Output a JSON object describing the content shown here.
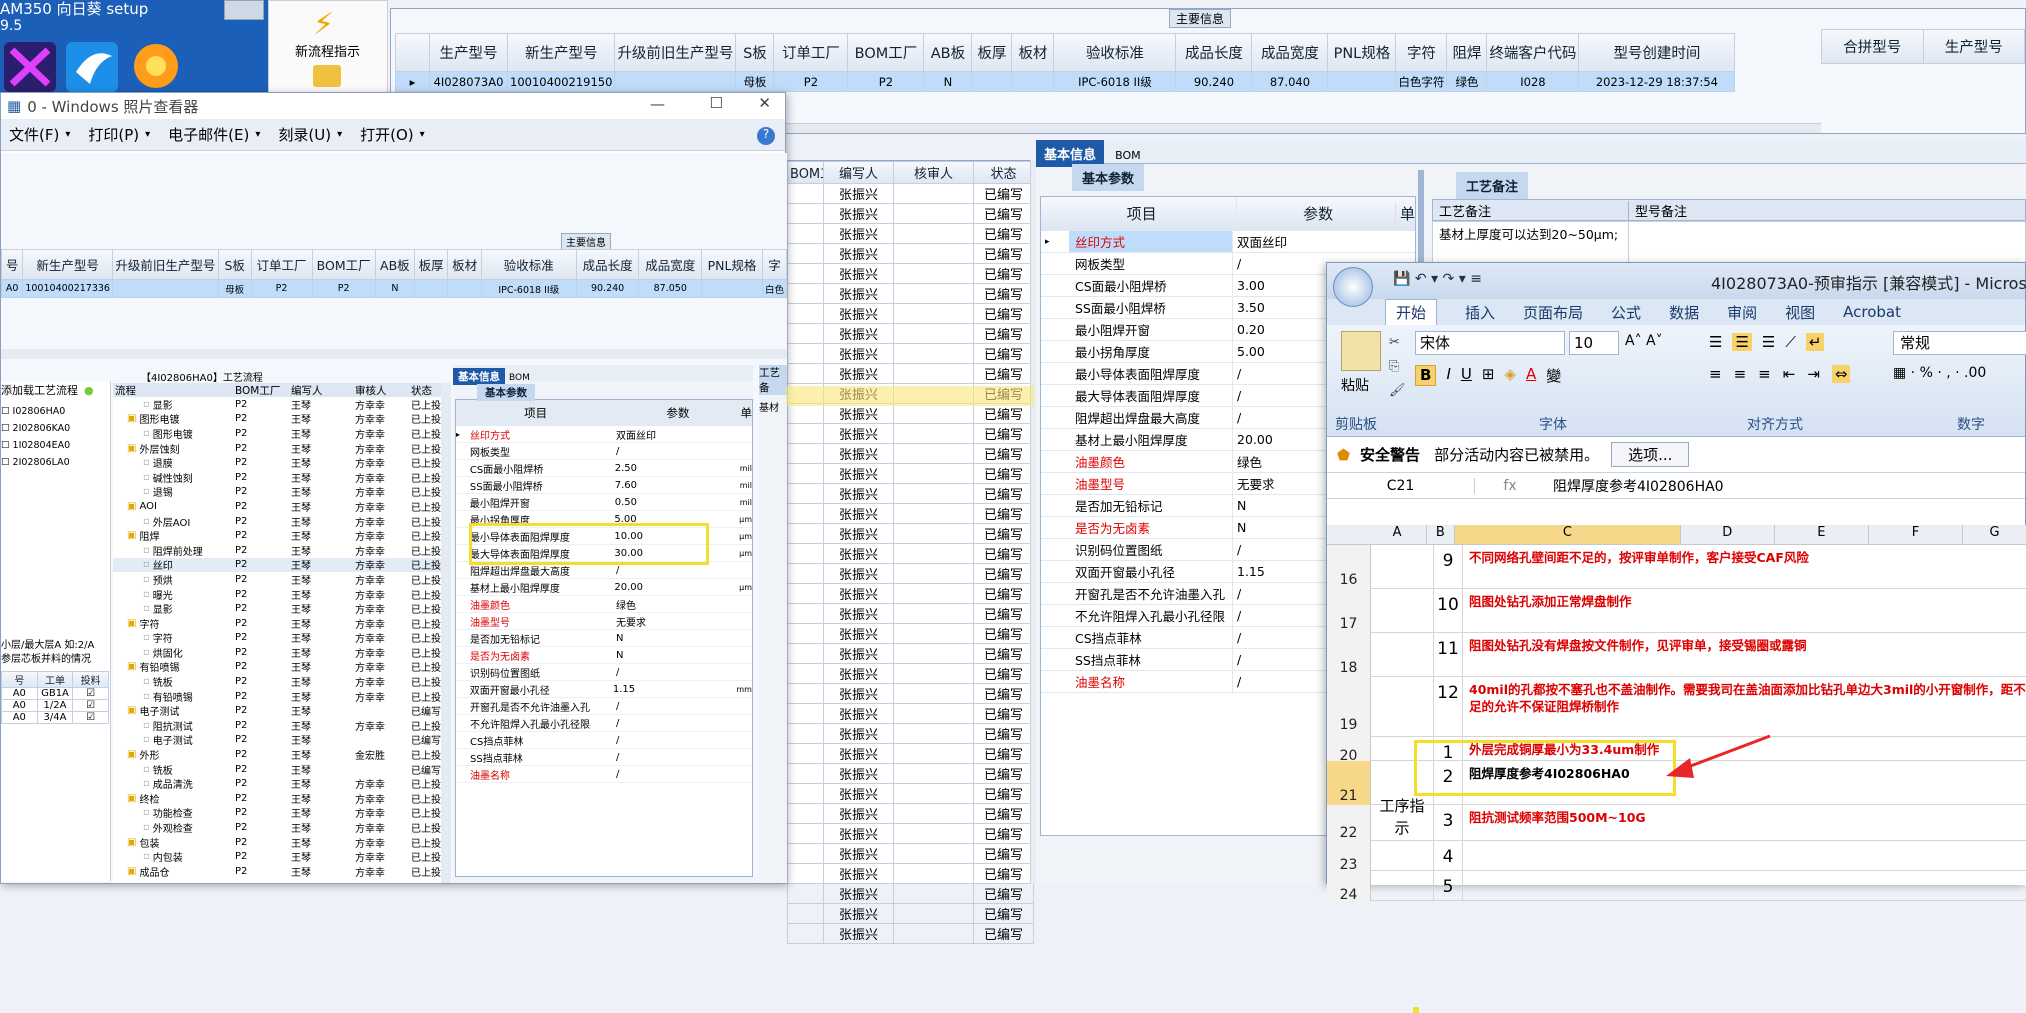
{
  "desktop": {
    "title": "AM350   向日葵    setup",
    "version": "9.5",
    "flow_label": "新流程指示"
  },
  "top_grid": {
    "caption": "主要信息",
    "columns": [
      "生产型号",
      "新生产型号",
      "升级前旧生产型号",
      "S板",
      "订单工厂",
      "BOM工厂",
      "AB板",
      "板厚",
      "板材",
      "验收标准",
      "成品长度",
      "成品宽度",
      "PNL规格",
      "字符",
      "阻焊",
      "终端客户代码",
      "型号创建时间"
    ],
    "row": [
      "4I028073A0",
      "10010400219150",
      "",
      "母板",
      "P2",
      "P2",
      "N",
      "",
      "",
      "IPC-6018 II级",
      "90.240",
      "87.040",
      "",
      "白色字符",
      "绿色",
      "I028",
      "2023-12-29 18:37:54"
    ],
    "right_columns": [
      "合拼型号",
      "生产型号"
    ]
  },
  "photo_viewer": {
    "title": "0 - Windows 照片查看器",
    "menu": [
      "文件(F)",
      "打印(P)",
      "电子邮件(E)",
      "刻录(U)",
      "打开(O)"
    ],
    "caption": "主要信息",
    "columns": [
      "号",
      "新生产型号",
      "升级前旧生产型号",
      "S板",
      "订单工厂",
      "BOM工厂",
      "AB板",
      "板厚",
      "板材",
      "验收标准",
      "成品长度",
      "成品宽度",
      "PNL规格",
      "字"
    ],
    "row": [
      "A0",
      "10010400217336",
      "",
      "母板",
      "P2",
      "P2",
      "N",
      "",
      "",
      "IPC-6018 II级",
      "90.240",
      "87.050",
      "",
      "白色"
    ],
    "flow_caption": "【4I02806HA0】工艺流程",
    "left_items": [
      "添加载工艺流程",
      "I02806HA0",
      "2I02806KA0",
      "1I02804EA0",
      "2I02806LA0"
    ],
    "note_lines": [
      "小层/最大层A 如:2/A",
      "参层芯板并料的情况"
    ],
    "small_table_head": [
      "号",
      "工单",
      "投料"
    ],
    "small_table_rows": [
      [
        "A0",
        "GB1A",
        ""
      ],
      [
        "A0",
        "1/2A",
        ""
      ],
      [
        "A0",
        "3/4A",
        ""
      ]
    ],
    "tree_head": [
      "流程",
      "BOM工厂",
      "编写人",
      "审核人",
      "状态"
    ],
    "tree": [
      {
        "t": "显影",
        "d": 2,
        "f": "P2",
        "w": "王琴",
        "r": "方幸幸",
        "s": "已上投"
      },
      {
        "t": "图形电镀",
        "d": 1,
        "f": "P2",
        "w": "王琴",
        "r": "方幸幸",
        "s": "已上投"
      },
      {
        "t": "图形电镀",
        "d": 2,
        "f": "P2",
        "w": "王琴",
        "r": "方幸幸",
        "s": "已上投"
      },
      {
        "t": "外层蚀刻",
        "d": 1,
        "f": "P2",
        "w": "王琴",
        "r": "方幸幸",
        "s": "已上投"
      },
      {
        "t": "退膜",
        "d": 2,
        "f": "P2",
        "w": "王琴",
        "r": "方幸幸",
        "s": "已上投"
      },
      {
        "t": "碱性蚀刻",
        "d": 2,
        "f": "P2",
        "w": "王琴",
        "r": "方幸幸",
        "s": "已上投"
      },
      {
        "t": "退锡",
        "d": 2,
        "f": "P2",
        "w": "王琴",
        "r": "方幸幸",
        "s": "已上投"
      },
      {
        "t": "AOI",
        "d": 1,
        "f": "P2",
        "w": "王琴",
        "r": "方幸幸",
        "s": "已上投"
      },
      {
        "t": "外层AOI",
        "d": 2,
        "f": "P2",
        "w": "王琴",
        "r": "方幸幸",
        "s": "已上投"
      },
      {
        "t": "阻焊",
        "d": 1,
        "f": "P2",
        "w": "王琴",
        "r": "方幸幸",
        "s": "已上投"
      },
      {
        "t": "阻焊前处理",
        "d": 2,
        "f": "P2",
        "w": "王琴",
        "r": "方幸幸",
        "s": "已上投"
      },
      {
        "t": "丝印",
        "d": 2,
        "f": "P2",
        "w": "王琴",
        "r": "方幸幸",
        "s": "已上投",
        "sel": true
      },
      {
        "t": "预烘",
        "d": 2,
        "f": "P2",
        "w": "王琴",
        "r": "方幸幸",
        "s": "已上投"
      },
      {
        "t": "曝光",
        "d": 2,
        "f": "P2",
        "w": "王琴",
        "r": "方幸幸",
        "s": "已上投"
      },
      {
        "t": "显影",
        "d": 2,
        "f": "P2",
        "w": "王琴",
        "r": "方幸幸",
        "s": "已上投"
      },
      {
        "t": "字符",
        "d": 1,
        "f": "P2",
        "w": "王琴",
        "r": "方幸幸",
        "s": "已上投"
      },
      {
        "t": "字符",
        "d": 2,
        "f": "P2",
        "w": "王琴",
        "r": "方幸幸",
        "s": "已上投"
      },
      {
        "t": "烘固化",
        "d": 2,
        "f": "P2",
        "w": "王琴",
        "r": "方幸幸",
        "s": "已上投"
      },
      {
        "t": "有铅喷锡",
        "d": 1,
        "f": "P2",
        "w": "王琴",
        "r": "方幸幸",
        "s": "已上投"
      },
      {
        "t": "铣板",
        "d": 2,
        "f": "P2",
        "w": "王琴",
        "r": "方幸幸",
        "s": "已上投"
      },
      {
        "t": "有铅喷锡",
        "d": 2,
        "f": "P2",
        "w": "王琴",
        "r": "方幸幸",
        "s": "已上投"
      },
      {
        "t": "电子测试",
        "d": 1,
        "f": "P2",
        "w": "王琴",
        "r": "",
        "s": "已编写"
      },
      {
        "t": "阻抗测试",
        "d": 2,
        "f": "P2",
        "w": "王琴",
        "r": "方幸幸",
        "s": "已上投"
      },
      {
        "t": "电子测试",
        "d": 2,
        "f": "P2",
        "w": "王琴",
        "r": "",
        "s": "已编写"
      },
      {
        "t": "外形",
        "d": 1,
        "f": "P2",
        "w": "王琴",
        "r": "金宏胜",
        "s": "已上投"
      },
      {
        "t": "铣板",
        "d": 2,
        "f": "P2",
        "w": "王琴",
        "r": "",
        "s": "已编写"
      },
      {
        "t": "成品清洗",
        "d": 2,
        "f": "P2",
        "w": "王琴",
        "r": "方幸幸",
        "s": "已上投"
      },
      {
        "t": "终检",
        "d": 1,
        "f": "P2",
        "w": "王琴",
        "r": "方幸幸",
        "s": "已上投"
      },
      {
        "t": "功能检查",
        "d": 2,
        "f": "P2",
        "w": "王琴",
        "r": "方幸幸",
        "s": "已上投"
      },
      {
        "t": "外观检查",
        "d": 2,
        "f": "P2",
        "w": "王琴",
        "r": "方幸幸",
        "s": "已上投"
      },
      {
        "t": "包装",
        "d": 1,
        "f": "P2",
        "w": "王琴",
        "r": "方幸幸",
        "s": "已上投"
      },
      {
        "t": "内包装",
        "d": 2,
        "f": "P2",
        "w": "王琴",
        "r": "方幸幸",
        "s": "已上投"
      },
      {
        "t": "成品仓",
        "d": 1,
        "f": "P2",
        "w": "王琴",
        "r": "方幸幸",
        "s": "已上投"
      }
    ],
    "basic_tab": "基本信息",
    "bom_tab": "BOM",
    "basic_params": "基本参数",
    "param_head": [
      "项目",
      "参数",
      "单"
    ],
    "params": [
      {
        "k": "丝印方式",
        "v": "双面丝印",
        "red": true,
        "u": ""
      },
      {
        "k": "网板类型",
        "v": "/",
        "u": ""
      },
      {
        "k": "CS面最小阻焊桥",
        "v": "2.50",
        "u": "mil"
      },
      {
        "k": "SS面最小阻焊桥",
        "v": "7.60",
        "u": "mil"
      },
      {
        "k": "最小阻焊开窗",
        "v": "0.50",
        "u": "mil"
      },
      {
        "k": "最小拐角厚度",
        "v": "5.00",
        "u": "μm"
      },
      {
        "k": "最小导体表面阻焊厚度",
        "v": "10.00",
        "u": "μm"
      },
      {
        "k": "最大导体表面阻焊厚度",
        "v": "30.00",
        "u": "μm"
      },
      {
        "k": "阻焊超出焊盘最大高度",
        "v": "/",
        "u": ""
      },
      {
        "k": "基材上最小阻焊厚度",
        "v": "20.00",
        "u": "μm"
      },
      {
        "k": "油墨颜色",
        "v": "绿色",
        "red": true,
        "u": ""
      },
      {
        "k": "油墨型号",
        "v": "无要求",
        "red": true,
        "u": ""
      },
      {
        "k": "是否加无铅标记",
        "v": "N",
        "u": ""
      },
      {
        "k": "是否为无卤素",
        "v": "N",
        "red": true,
        "u": ""
      },
      {
        "k": "识别码位置图纸",
        "v": "/",
        "u": ""
      },
      {
        "k": "双面开窗最小孔径",
        "v": "1.15",
        "u": "mm"
      },
      {
        "k": "开窗孔是否不允许油墨入孔",
        "v": "/",
        "u": ""
      },
      {
        "k": "不允许阻焊入孔最小孔径限",
        "v": "/",
        "u": ""
      },
      {
        "k": "CS挡点菲林",
        "v": "/",
        "u": ""
      },
      {
        "k": "SS挡点菲林",
        "v": "/",
        "u": ""
      },
      {
        "k": "油墨名称",
        "v": "/",
        "red": true,
        "u": ""
      }
    ],
    "side_tab": "工艺备",
    "side_sub": "基材"
  },
  "middle_list": {
    "head": [
      "BOM工厂",
      "编写人",
      "核审人",
      "状态"
    ],
    "writer": "张振兴",
    "status": "已编写",
    "rows": 38
  },
  "right_detail": {
    "tab_basic": "基本信息",
    "tab_bom": "BOM",
    "basic_params": "基本参数",
    "head": [
      "项目",
      "参数",
      "单"
    ],
    "params": [
      {
        "k": "丝印方式",
        "v": "双面丝印",
        "red": true
      },
      {
        "k": "网板类型",
        "v": "/"
      },
      {
        "k": "CS面最小阻焊桥",
        "v": "3.00"
      },
      {
        "k": "SS面最小阻焊桥",
        "v": "3.50"
      },
      {
        "k": "最小阻焊开窗",
        "v": "0.20"
      },
      {
        "k": "最小拐角厚度",
        "v": "5.00"
      },
      {
        "k": "最小导体表面阻焊厚度",
        "v": "/"
      },
      {
        "k": "最大导体表面阻焊厚度",
        "v": "/"
      },
      {
        "k": "阻焊超出焊盘最大高度",
        "v": "/"
      },
      {
        "k": "基材上最小阻焊厚度",
        "v": "20.00"
      },
      {
        "k": "油墨颜色",
        "v": "绿色",
        "red": true
      },
      {
        "k": "油墨型号",
        "v": "无要求",
        "red": true
      },
      {
        "k": "是否加无铅标记",
        "v": "N"
      },
      {
        "k": "是否为无卤素",
        "v": "N",
        "red": true
      },
      {
        "k": "识别码位置图纸",
        "v": "/"
      },
      {
        "k": "双面开窗最小孔径",
        "v": "1.15"
      },
      {
        "k": "开窗孔是否不允许油墨入孔",
        "v": "/"
      },
      {
        "k": "不允许阻焊入孔最小孔径限",
        "v": "/"
      },
      {
        "k": "CS挡点菲林",
        "v": "/"
      },
      {
        "k": "SS挡点菲林",
        "v": "/"
      },
      {
        "k": "油墨名称",
        "v": "/",
        "red": true
      }
    ],
    "remark_tab": "工艺备注",
    "remark_head": [
      "工艺备注",
      "型号备注"
    ],
    "remark_text": "基材上厚度可以达到20~50μm;"
  },
  "excel": {
    "title": "4I028073A0-预审指示 [兼容模式] - Microsoft",
    "tabs": [
      "开始",
      "插入",
      "页面布局",
      "公式",
      "数据",
      "审阅",
      "视图",
      "Acrobat"
    ],
    "font": "宋体",
    "size": "10",
    "numfmt": "常规",
    "paste": "粘贴",
    "groups": [
      "剪贴板",
      "字体",
      "对齐方式",
      "数字"
    ],
    "warn_title": "安全警告",
    "warn_text": "部分活动内容已被禁用。",
    "warn_btn": "选项...",
    "namebox": "C21",
    "formula": "阻焊厚度参考4I02806HA0",
    "fx": "fx",
    "cols": [
      "A",
      "B",
      "C",
      "D",
      "E",
      "F",
      "G"
    ],
    "rows": [
      {
        "n": "16",
        "b": "9",
        "c": "不同网络孔壁间距不足的，按评审单制作，客户接受CAF风险",
        "red": true
      },
      {
        "n": "17",
        "b": "10",
        "c": "阻图处钻孔添加正常焊盘制作",
        "red": true
      },
      {
        "n": "18",
        "b": "11",
        "c": "阻图处钻孔没有焊盘按文件制作，见评审单，接受锡圈或露铜",
        "red": true
      },
      {
        "n": "19",
        "b": "12",
        "c": "40mil的孔都按不塞孔也不盖油制作。需要我司在盖油面添加比钻孔单边大3mil的小开窗制作，距不足的允许不保证阻焊桥制作",
        "red": true
      },
      {
        "n": "20",
        "b": "1",
        "c": "外层完成铜厚最小为33.4um制作",
        "red": true
      },
      {
        "n": "21",
        "b": "2",
        "c": "阻焊厚度参考4I02806HA0",
        "red": false
      },
      {
        "n": "22",
        "b": "3",
        "c": "阻抗测试频率范围500M~10G",
        "red": true
      },
      {
        "n": "23",
        "b": "4",
        "c": "",
        "red": false
      },
      {
        "n": "24",
        "b": "5",
        "c": "",
        "red": false
      }
    ],
    "section_label": "工序指示"
  }
}
